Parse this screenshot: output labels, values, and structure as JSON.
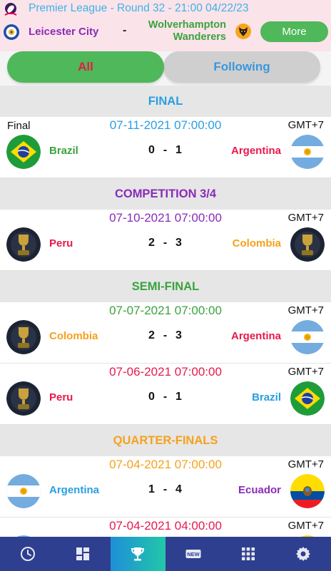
{
  "banner": {
    "title": "Premier League - Round 32 - 21:00 04/22/23",
    "home_team": "Leicester City",
    "separator": "-",
    "away_team": "Wolverhampton Wanderers",
    "more_label": "More",
    "league_icon": "premier-league-lion-icon",
    "home_icon": "leicester-crest-icon",
    "away_icon": "wolves-crest-icon"
  },
  "tabs": {
    "all_label": "All",
    "following_label": "Following"
  },
  "sections": [
    {
      "title": "FINAL",
      "color": "#2a9ee0",
      "matches": [
        {
          "round": "Final",
          "date": "07-11-2021 07:00:00",
          "date_color": "#2a9ee0",
          "tz": "GMT+7",
          "home": "Brazil",
          "home_color": "#3aa33e",
          "home_logo": "brazil-flag",
          "score_home": "0",
          "score_away": "1",
          "away": "Argentina",
          "away_color": "#e8194b",
          "away_logo": "argentina-flag"
        }
      ]
    },
    {
      "title": "COMPETITION 3/4",
      "color": "#8a2bb8",
      "matches": [
        {
          "round": "",
          "date": "07-10-2021 07:00:00",
          "date_color": "#8a2bb8",
          "tz": "GMT+7",
          "home": "Peru",
          "home_color": "#e8194b",
          "home_logo": "trophy-placeholder",
          "score_home": "2",
          "score_away": "3",
          "away": "Colombia",
          "away_color": "#f5a11c",
          "away_logo": "trophy-placeholder"
        }
      ]
    },
    {
      "title": "SEMI-FINAL",
      "color": "#3aa33e",
      "matches": [
        {
          "round": "",
          "date": "07-07-2021 07:00:00",
          "date_color": "#3aa33e",
          "tz": "GMT+7",
          "home": "Colombia",
          "home_color": "#f5a11c",
          "home_logo": "trophy-placeholder",
          "score_home": "2",
          "score_away": "3",
          "away": "Argentina",
          "away_color": "#e8194b",
          "away_logo": "argentina-flag"
        },
        {
          "round": "",
          "date": "07-06-2021 07:00:00",
          "date_color": "#e8194b",
          "tz": "GMT+7",
          "home": "Peru",
          "home_color": "#e8194b",
          "home_logo": "trophy-placeholder",
          "score_home": "0",
          "score_away": "1",
          "away": "Brazil",
          "away_color": "#2a9ee0",
          "away_logo": "brazil-flag"
        }
      ]
    },
    {
      "title": "QUARTER-FINALS",
      "color": "#f5a11c",
      "matches": [
        {
          "round": "",
          "date": "07-04-2021 07:00:00",
          "date_color": "#f5a11c",
          "tz": "GMT+7",
          "home": "Argentina",
          "home_color": "#2a9ee0",
          "home_logo": "argentina-flag",
          "score_home": "1",
          "score_away": "4",
          "away": "Ecuador",
          "away_color": "#8a2bb8",
          "away_logo": "ecuador-flag"
        },
        {
          "round": "",
          "date": "07-04-2021 04:00:00",
          "date_color": "#e8194b",
          "tz": "GMT+7",
          "home": "",
          "home_color": "#2a9ee0",
          "home_logo": "argentina-flag",
          "score_home": "",
          "score_away": "",
          "away": "",
          "away_color": "#8a2bb8",
          "away_logo": "ecuador-flag"
        }
      ]
    }
  ],
  "nav": {
    "items": [
      "clock-icon",
      "dashboard-icon",
      "trophy-icon",
      "new-icon",
      "apps-grid-icon",
      "settings-gear-icon"
    ],
    "active_index": 2,
    "new_badge_text": "NEW"
  }
}
